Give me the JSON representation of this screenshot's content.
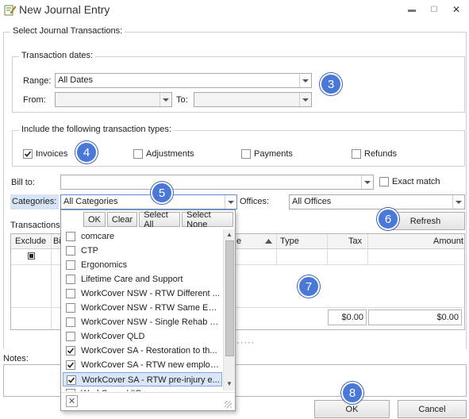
{
  "window": {
    "title": "New Journal Entry"
  },
  "select_section": {
    "label": "Select Journal Transactions:"
  },
  "transaction_dates": {
    "label": "Transaction dates:",
    "range_label": "Range:",
    "range_value": "All Dates",
    "from_label": "From:",
    "to_label": "To:"
  },
  "transaction_types": {
    "label": "Include the following transaction types:",
    "items": [
      {
        "label": "Invoices",
        "checked": true
      },
      {
        "label": "Adjustments",
        "checked": false
      },
      {
        "label": "Payments",
        "checked": false
      },
      {
        "label": "Refunds",
        "checked": false
      }
    ]
  },
  "bill_to": {
    "label": "Bill to:",
    "value": "",
    "exact_match_label": "Exact match"
  },
  "categories": {
    "label": "Categories:",
    "value": "All Categories"
  },
  "offices": {
    "label": "Offices:",
    "value": "All Offices"
  },
  "refresh_label": "Refresh",
  "transactions": {
    "label": "Transactions",
    "columns": [
      "Exclude",
      "Bi",
      "e",
      "Type",
      "Tax",
      "Amount"
    ],
    "tax_total": "$0.00",
    "amount_total": "$0.00"
  },
  "dropdown": {
    "buttons": [
      "OK",
      "Clear",
      "Select All",
      "Select None"
    ],
    "items": [
      {
        "label": "comcare",
        "checked": false
      },
      {
        "label": "CTP",
        "checked": false
      },
      {
        "label": "Ergonomics",
        "checked": false
      },
      {
        "label": "Lifetime Care and Support",
        "checked": false
      },
      {
        "label": "WorkCover NSW - RTW Different ...",
        "checked": false
      },
      {
        "label": "WorkCover NSW - RTW Same Em...",
        "checked": false
      },
      {
        "label": "WorkCover NSW - Single Rehab S...",
        "checked": false
      },
      {
        "label": "WorkCover QLD",
        "checked": false
      },
      {
        "label": "WorkCover SA - Restoration to th...",
        "checked": true
      },
      {
        "label": "WorkCover SA - RTW new employer",
        "checked": true
      },
      {
        "label": "WorkCover SA - RTW pre-injury e...",
        "checked": true
      },
      {
        "label": "WorkCover VIC",
        "checked": false
      }
    ]
  },
  "notes": {
    "label": "Notes:",
    "value": ""
  },
  "ok_label": "OK",
  "cancel_label": "Cancel",
  "badges": [
    "3",
    "4",
    "5",
    "6",
    "7",
    "8"
  ],
  "colors": {
    "badge": "#4a78d8",
    "highlight_label": "#d6e4f5",
    "dropdown_highlight": "#d8e6f7"
  }
}
